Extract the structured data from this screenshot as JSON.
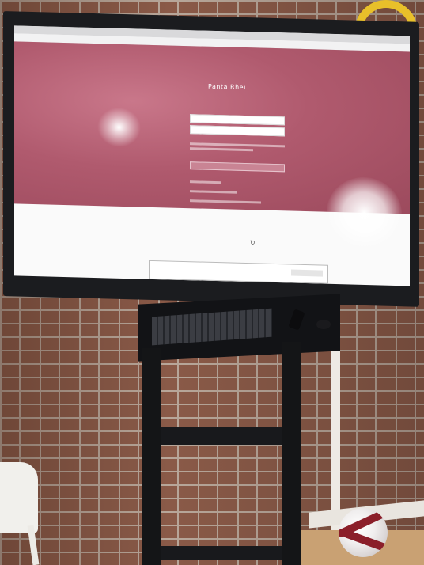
{
  "screen_page": {
    "logo_text": "Panta Rhei",
    "heading_text": "",
    "username_placeholder": "",
    "password_placeholder": "",
    "login_button": ""
  },
  "colors": {
    "page_accent": "#b05a6e",
    "bezel": "#1b1c1f",
    "ball_accent": "#8b1f2a",
    "wall_brick": "#8a5a48"
  },
  "icons": [
    "spinner-icon",
    "windows-start-icon",
    "taskbar-app-icon"
  ]
}
